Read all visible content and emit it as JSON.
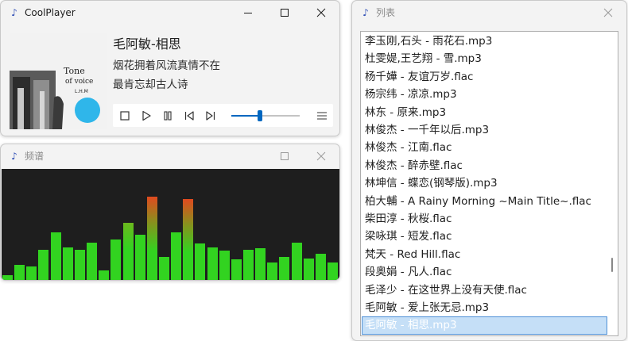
{
  "player": {
    "title": "CoolPlayer",
    "song_title": "毛阿敏-相思",
    "lyrics": [
      "烟花拥着风流真情不在",
      "最肯忘却古人诗"
    ],
    "seek_progress": 0.42,
    "cover_text": [
      "Tone",
      "of voice",
      "L.H.M"
    ]
  },
  "spectrum": {
    "title": "频谱",
    "bar_levels": [
      0.05,
      0.14,
      0.13,
      0.28,
      0.43,
      0.3,
      0.28,
      0.34,
      0.09,
      0.37,
      0.52,
      0.41,
      0.75,
      0.21,
      0.43,
      0.73,
      0.33,
      0.3,
      0.27,
      0.19,
      0.28,
      0.29,
      0.16,
      0.21,
      0.34,
      0.2,
      0.24,
      0.16
    ],
    "bar_colors": {
      "low": "#32d320",
      "high": "#e04a1f"
    }
  },
  "playlist": {
    "title": "列表",
    "items": [
      "李玉刚,石头 - 雨花石.mp3",
      "杜雯媞,王艺翔 - 雪.mp3",
      "杨千嬅 - 友谊万岁.flac",
      "杨宗纬 - 凉凉.mp3",
      "林东 - 原来.mp3",
      "林俊杰 - 一千年以后.mp3",
      "林俊杰 - 江南.flac",
      "林俊杰 - 醉赤壁.flac",
      "林坤信 - 蝶恋(钢琴版).mp3",
      "柏大輔 - A Rainy Morning ~Main Title~.flac",
      "柴田淳 - 秋桜.flac",
      "梁咏琪 - 短发.flac",
      "梵天 - Red Hill.flac",
      "段奥娟 - 凡人.flac",
      "毛泽少 - 在这世界上没有天使.flac",
      "毛阿敏 - 爱上张无忌.mp3",
      "毛阿敏 - 相思.mp3"
    ],
    "selected_index": 16,
    "scroll_position": 0.78
  },
  "colors": {
    "accent": "#0067c0",
    "selection": "#c5dff7",
    "spectrum_bg": "#1e1e1e"
  }
}
